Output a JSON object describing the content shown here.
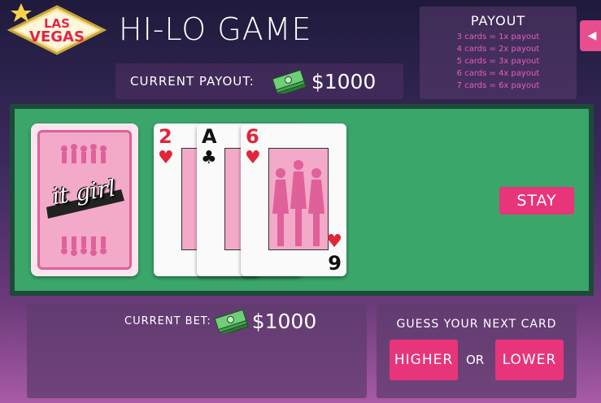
{
  "logo": {
    "line1": "LAS",
    "line2": "VEGAS"
  },
  "title": "HI-LO GAME",
  "payout_table": {
    "title": "PAYOUT",
    "lines": [
      "3 cards = 1x payout",
      "4 cards = 2x payout",
      "5 cards = 3x payout",
      "6 cards = 4x payout",
      "7 cards = 6x payout"
    ]
  },
  "side_tab": {
    "icon": "left-arrow-icon",
    "glyph": "◀"
  },
  "current_payout": {
    "label": "CURRENT PAYOUT:",
    "amount": "$1000",
    "icon": "cash-stack-icon"
  },
  "deck": {
    "brand": "it girl",
    "icon": "card-back-icon"
  },
  "cards": [
    {
      "rank": "2",
      "suit": "♥",
      "color": "red"
    },
    {
      "rank": "A",
      "suit": "♣",
      "color": "black"
    },
    {
      "rank": "6",
      "suit": "♥",
      "color": "red",
      "corner_rank": "9",
      "corner_suit": "♥"
    }
  ],
  "stay_button": "STAY",
  "current_bet": {
    "label": "CURRENT BET:",
    "amount": "$1000",
    "icon": "cash-stack-icon"
  },
  "guess": {
    "title": "GUESS YOUR NEXT CARD",
    "higher": "HIGHER",
    "or": "OR",
    "lower": "LOWER"
  },
  "colors": {
    "accent_pink": "#e8357a",
    "felt_green": "#3aa66a",
    "payout_text": "#e85cc0"
  }
}
